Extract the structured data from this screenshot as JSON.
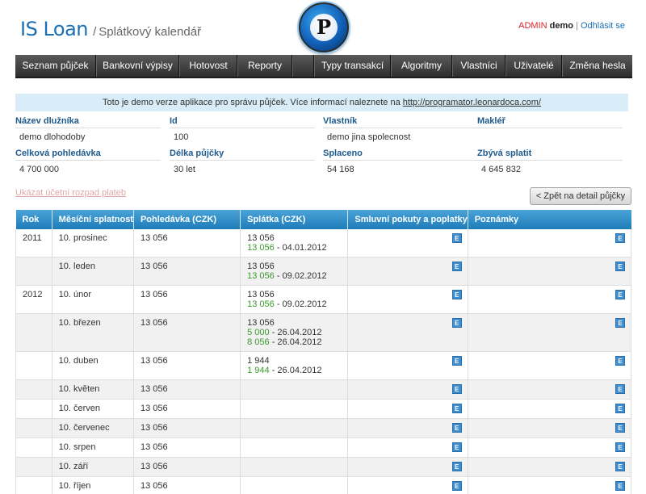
{
  "header": {
    "app_name": "IS Loan",
    "separator": "/",
    "page_title": "Splátkový kalendář",
    "logo_letter": "P",
    "user_role": "ADMIN",
    "user_name": "demo",
    "user_separator": "|",
    "logout_label": "Odhlásit se"
  },
  "menu": {
    "items": [
      "Seznam půjček",
      "Bankovní výpisy",
      "Hotovost",
      "Reporty",
      "",
      "Typy transakcí",
      "Algoritmy",
      "Vlastníci",
      "Uživatelé",
      "Změna hesla"
    ]
  },
  "notice": {
    "text": "Toto je demo verze aplikace pro správu půjček. Více informací naleznete na ",
    "link": "http://programator.leonardoca.com/"
  },
  "loan": {
    "debtor_label": "Název dlužníka",
    "debtor": "demo dlohodoby",
    "id_label": "Id",
    "id": "100",
    "owner_label": "Vlastník",
    "owner": "demo jina spolecnost",
    "broker_label": "Makléř",
    "broker": "",
    "total_label": "Celková pohledávka",
    "total": "4 700 000",
    "length_label": "Délka půjčky",
    "length": "30 let",
    "paid_label": "Splaceno",
    "paid": "54 168",
    "remaining_label": "Zbývá splatit",
    "remaining": "4 645 832"
  },
  "actions": {
    "show_breakdown": "Ukázat účetní rozpad plateb",
    "back_button": "< Zpět na detail půjčky"
  },
  "table": {
    "headers": [
      "Rok",
      "Měsíční splatnost",
      "Pohledávka (CZK)",
      "Splátka (CZK)",
      "Smluvní pokuty a poplatky",
      "Poznámky"
    ],
    "edit_label": "E",
    "rows": [
      {
        "year": "2011",
        "due": "10. prosinec",
        "claim": "13 056",
        "installment": "13 056",
        "payments": [
          {
            "amount": "13 056",
            "date": "04.01.2012"
          }
        ]
      },
      {
        "year": "",
        "due": "10. leden",
        "claim": "13 056",
        "installment": "13 056",
        "payments": [
          {
            "amount": "13 056",
            "date": "09.02.2012"
          }
        ]
      },
      {
        "year": "2012",
        "due": "10. únor",
        "claim": "13 056",
        "installment": "13 056",
        "payments": [
          {
            "amount": "13 056",
            "date": "09.02.2012"
          }
        ]
      },
      {
        "year": "",
        "due": "10. březen",
        "claim": "13 056",
        "installment": "13 056",
        "payments": [
          {
            "amount": "5 000",
            "date": "26.04.2012"
          },
          {
            "amount": "8 056",
            "date": "26.04.2012"
          }
        ]
      },
      {
        "year": "",
        "due": "10. duben",
        "claim": "13 056",
        "installment": "1 944",
        "payments": [
          {
            "amount": "1 944",
            "date": "26.04.2012"
          }
        ]
      },
      {
        "year": "",
        "due": "10. květen",
        "claim": "13 056",
        "installment": "",
        "payments": []
      },
      {
        "year": "",
        "due": "10. červen",
        "claim": "13 056",
        "installment": "",
        "payments": []
      },
      {
        "year": "",
        "due": "10. červenec",
        "claim": "13 056",
        "installment": "",
        "payments": []
      },
      {
        "year": "",
        "due": "10. srpen",
        "claim": "13 056",
        "installment": "",
        "payments": []
      },
      {
        "year": "",
        "due": "10. září",
        "claim": "13 056",
        "installment": "",
        "payments": []
      },
      {
        "year": "",
        "due": "10. říjen",
        "claim": "13 056",
        "installment": "",
        "payments": []
      }
    ]
  },
  "colors": {
    "brand_blue": "#1a6fb5",
    "header_blue": "#1f7cb9",
    "payment_green": "#3a9a2a",
    "admin_red": "#d9252b"
  }
}
